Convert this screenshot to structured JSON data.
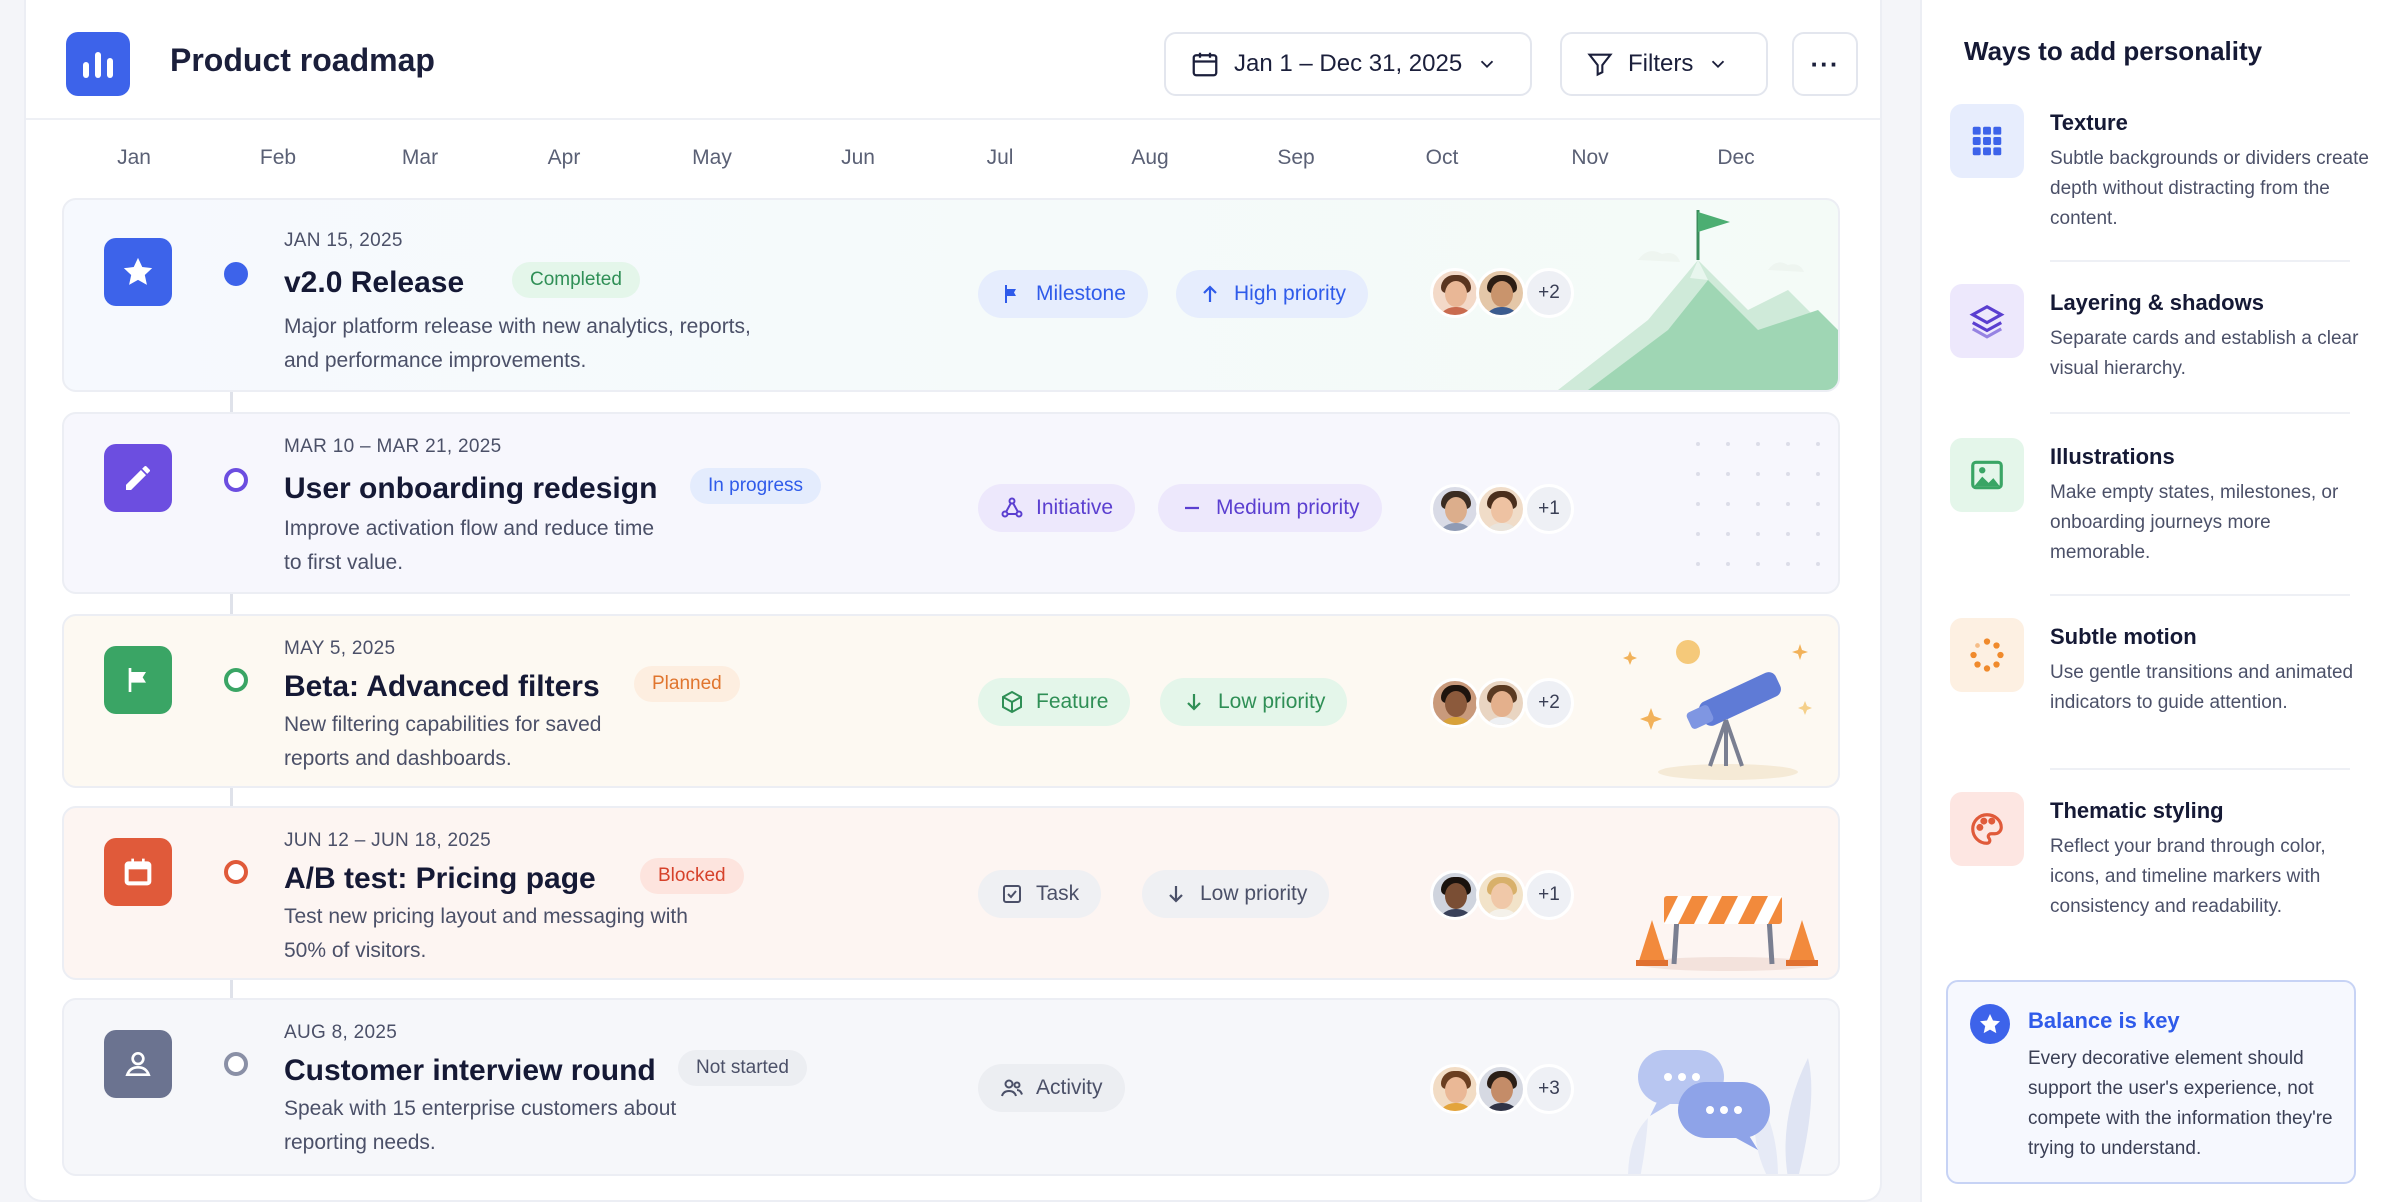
{
  "app": {
    "title": "Product roadmap",
    "date_range": "Jan 1 – Dec 31, 2025",
    "filters_label": "Filters",
    "more_label": "···"
  },
  "months": [
    "Jan",
    "Feb",
    "Mar",
    "Apr",
    "May",
    "Jun",
    "Jul",
    "Aug",
    "Sep",
    "Oct",
    "Nov",
    "Dec"
  ],
  "items": [
    {
      "date": "JAN 15, 2025",
      "title": "v2.0 Release",
      "status": "Completed",
      "description": "Major platform release with new analytics, reports, and performance improvements.",
      "type": "Milestone",
      "priority": "High priority",
      "more": "+2",
      "accent": "#3d63ea",
      "icon": "star-icon"
    },
    {
      "date": "MAR 10 – MAR 21, 2025",
      "title": "User onboarding redesign",
      "status": "In progress",
      "description": "Improve activation flow and reduce time to first value.",
      "type": "Initiative",
      "priority": "Medium priority",
      "more": "+1",
      "accent": "#6c4ee0",
      "icon": "pencil-icon"
    },
    {
      "date": "MAY 5, 2025",
      "title": "Beta: Advanced filters",
      "status": "Planned",
      "description": "New filtering capabilities for saved reports and dashboards.",
      "type": "Feature",
      "priority": "Low priority",
      "more": "+2",
      "accent": "#3aa565",
      "icon": "flag-icon"
    },
    {
      "date": "JUN 12 – JUN 18, 2025",
      "title": "A/B test: Pricing page",
      "status": "Blocked",
      "description": "Test new pricing layout and messaging with 50% of visitors.",
      "type": "Task",
      "priority": "Low priority",
      "more": "+1",
      "accent": "#e05a3a",
      "icon": "calendar-icon"
    },
    {
      "date": "AUG 8, 2025",
      "title": "Customer interview round",
      "status": "Not started",
      "description": "Speak with 15 enterprise customers about reporting needs.",
      "type": "Activity",
      "priority": "",
      "more": "+3",
      "accent": "#6b7390",
      "icon": "user-icon"
    }
  ],
  "sidebar": {
    "title": "Ways to add personality",
    "tips": [
      {
        "title": "Texture",
        "text": "Subtle backgrounds or dividers create depth without distracting from the content.",
        "icon": "grid-icon"
      },
      {
        "title": "Layering & shadows",
        "text": "Separate cards and establish a clear visual hierarchy.",
        "icon": "layers-icon"
      },
      {
        "title": "Illustrations",
        "text": "Make empty states, milestones, or onboarding journeys more memorable.",
        "icon": "image-icon"
      },
      {
        "title": "Subtle motion",
        "text": "Use gentle transitions and animated indicators to guide attention.",
        "icon": "spinner-icon"
      },
      {
        "title": "Thematic styling",
        "text": "Reflect your brand through color, icons, and timeline markers with consistency and readability.",
        "icon": "palette-icon"
      }
    ],
    "balance": {
      "title": "Balance is key",
      "text": "Every decorative element should support the user's experience, not compete with the information they're trying to understand."
    }
  }
}
